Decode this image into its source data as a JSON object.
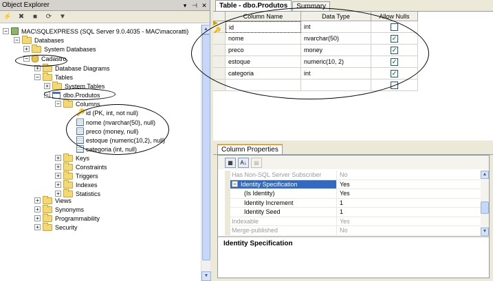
{
  "object_explorer": {
    "title": "Object Explorer",
    "title_controls": [
      "▾",
      "⊣",
      "✕"
    ],
    "toolbar_icons": [
      "connect-icon",
      "disconnect-icon",
      "stop-icon",
      "refresh-icon",
      "filter-icon"
    ],
    "server": "MAC\\SQLEXPRESS (SQL Server 9.0.4035 - MAC\\macoratti)",
    "databases": "Databases",
    "system_databases": "System Databases",
    "cadastro": "Cadastro",
    "database_diagrams": "Database Diagrams",
    "tables": "Tables",
    "system_tables": "System Tables",
    "dbo_produtos": "dbo.Produtos",
    "columns": "Columns",
    "column_items": [
      "id (PK, int, not null)",
      "nome (nvarchar(50), null)",
      "preco (money, null)",
      "estoque (numeric(10,2), null)",
      "categoria (int, null)"
    ],
    "keys": "Keys",
    "constraints": "Constraints",
    "triggers": "Triggers",
    "indexes": "Indexes",
    "statistics": "Statistics",
    "views": "Views",
    "synonyms": "Synonyms",
    "programmability": "Programmability",
    "security": "Security"
  },
  "designer": {
    "tab_active": "Table - dbo.Produtos",
    "tab_summary": "Summary",
    "headers": {
      "name": "Column Name",
      "type": "Data Type",
      "nulls": "Allow Nulls"
    },
    "rows": [
      {
        "name": "id",
        "type": "int",
        "nulls": false
      },
      {
        "name": "nome",
        "type": "nvarchar(50)",
        "nulls": true
      },
      {
        "name": "preco",
        "type": "money",
        "nulls": true
      },
      {
        "name": "estoque",
        "type": "numeric(10, 2)",
        "nulls": true
      },
      {
        "name": "categoria",
        "type": "int",
        "nulls": true
      },
      {
        "name": "",
        "type": "",
        "nulls": false
      }
    ],
    "check_mark": "✓"
  },
  "column_properties": {
    "tab": "Column Properties",
    "props": [
      {
        "name": "Has Non-SQL Server Subscriber",
        "value": "No"
      },
      {
        "name": "Identity Specification",
        "value": "Yes"
      },
      {
        "name": "(Is Identity)",
        "value": "Yes"
      },
      {
        "name": "Identity Increment",
        "value": "1"
      },
      {
        "name": "Identity Seed",
        "value": "1"
      },
      {
        "name": "Indexable",
        "value": "Yes"
      },
      {
        "name": "Merge-published",
        "value": "No"
      }
    ],
    "description": "Identity Specification"
  }
}
